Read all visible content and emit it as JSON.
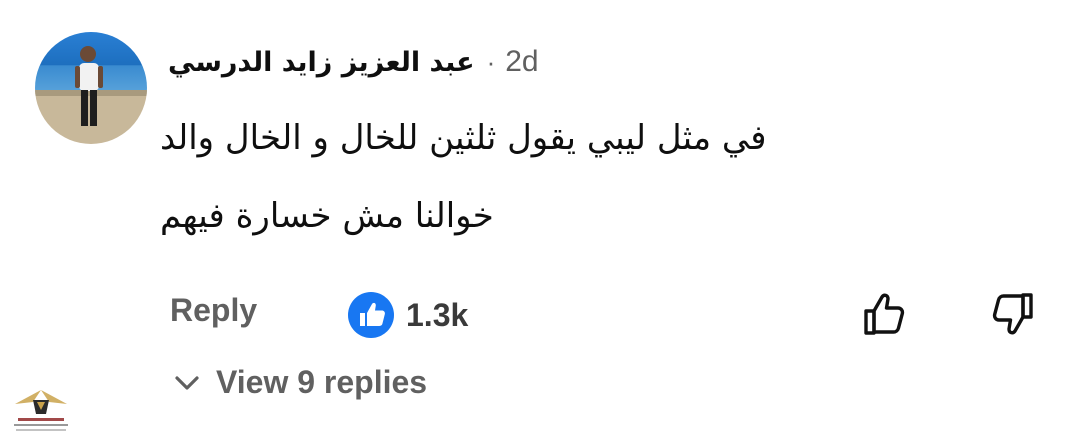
{
  "comment": {
    "author": "عبد العزيز زايد الدرسي",
    "separator": "·",
    "age": "2d",
    "text_lines": [
      "في مثل ليبي يقول ثلثين للخال و الخال والد",
      "خوالنا مش خسارة فيهم"
    ]
  },
  "actions": {
    "reply_label": "Reply",
    "reaction_count": "1.3k",
    "reaction_icon": "like-thumbs-up-icon",
    "like_icon": "thumb-up-outline-icon",
    "dislike_icon": "thumb-down-outline-icon"
  },
  "replies": {
    "label": "View 9 replies",
    "icon": "chevron-down-icon"
  },
  "colors": {
    "primary_text": "#0f0f0f",
    "secondary_text": "#606060",
    "like_blue": "#1877f2"
  }
}
